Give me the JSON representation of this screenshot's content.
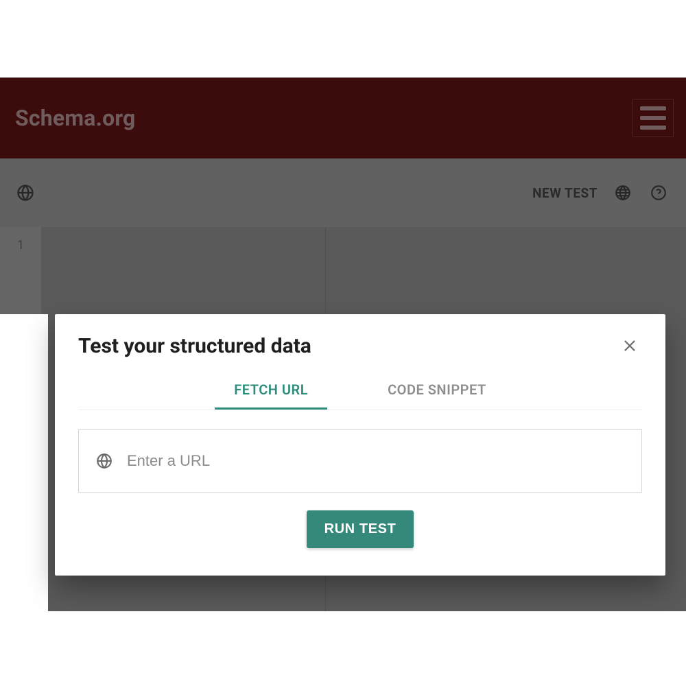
{
  "header": {
    "brand": "Schema.org"
  },
  "toolbar": {
    "new_test": "NEW TEST"
  },
  "editor": {
    "line_numbers": [
      "1"
    ]
  },
  "modal": {
    "title": "Test your structured data",
    "tabs": [
      {
        "id": "fetch-url",
        "label": "FETCH URL",
        "active": true
      },
      {
        "id": "code-snippet",
        "label": "CODE SNIPPET",
        "active": false
      }
    ],
    "url_placeholder": "Enter a URL",
    "url_value": "",
    "run_button": "RUN TEST"
  },
  "colors": {
    "accent": "#34897a",
    "header_bg": "#571211"
  }
}
